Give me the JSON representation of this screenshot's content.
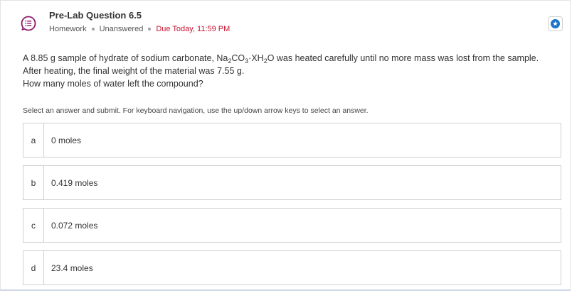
{
  "header": {
    "title": "Pre-Lab Question 6.5",
    "category": "Homework",
    "status": "Unanswered",
    "due": "Due Today, 11:59 PM",
    "icon": "question-list-icon",
    "accent_color": "#8a1a6b",
    "due_color": "#c8102e"
  },
  "question": {
    "line1_pre": "A 8.85 g sample of hydrate of sodium carbonate, Na",
    "sub1": "2",
    "co": "CO",
    "sub2": "3",
    "dot_x": "·XH",
    "sub3": "2",
    "line1_post": "O was heated carefully until no more mass was lost from the sample.",
    "line2": "After heating, the final weight of the material was 7.55 g.",
    "line3": "How many moles of water left the compound?"
  },
  "instructions": "Select an answer and submit. For keyboard navigation, use the up/down arrow keys to select an answer.",
  "options": [
    {
      "letter": "a",
      "text": "0 moles"
    },
    {
      "letter": "b",
      "text": "0.419 moles"
    },
    {
      "letter": "c",
      "text": "0.072 moles"
    },
    {
      "letter": "d",
      "text": "23.4 moles"
    }
  ],
  "star_button": {
    "icon": "star-icon",
    "color": "#1a73c8"
  }
}
